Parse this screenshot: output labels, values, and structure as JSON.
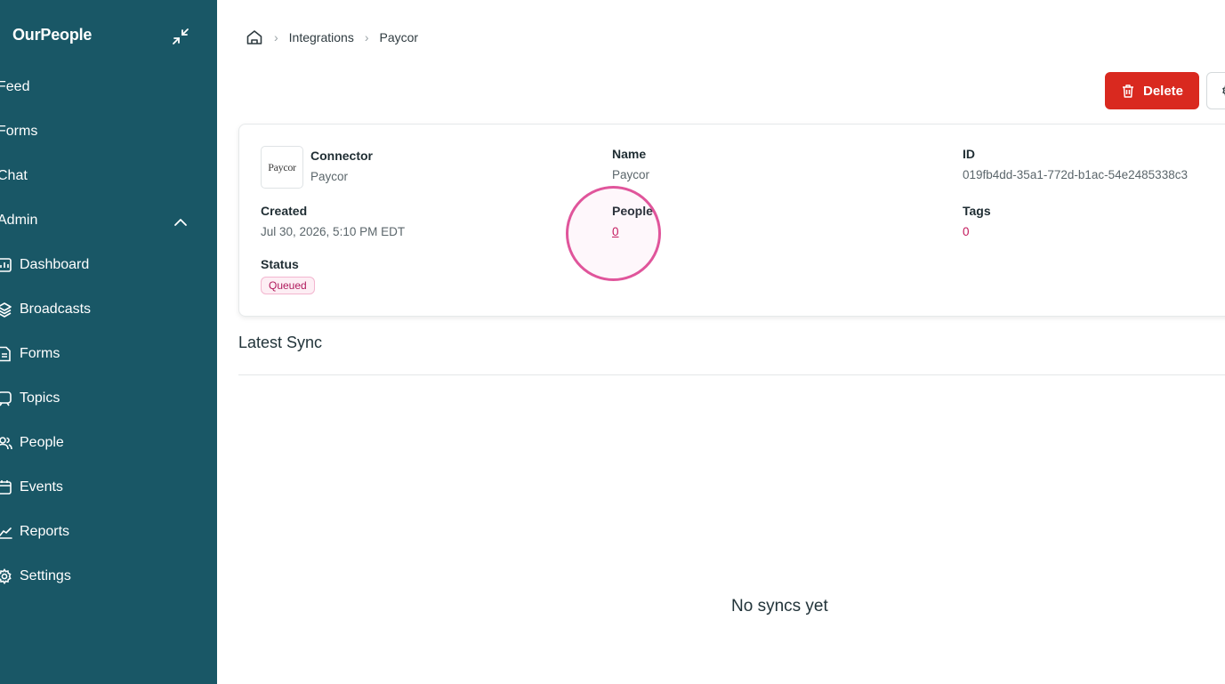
{
  "sidebar": {
    "brand": "OurPeople",
    "items": [
      {
        "label": "Feed"
      },
      {
        "label": "Forms"
      },
      {
        "label": "Chat"
      },
      {
        "label": "Admin"
      }
    ],
    "admin_items": [
      {
        "label": "Dashboard",
        "icon": "dashboard-icon"
      },
      {
        "label": "Broadcasts",
        "icon": "broadcasts-icon"
      },
      {
        "label": "Forms",
        "icon": "forms-icon"
      },
      {
        "label": "Topics",
        "icon": "topics-icon"
      },
      {
        "label": "People",
        "icon": "people-icon"
      },
      {
        "label": "Events",
        "icon": "calendar-icon"
      },
      {
        "label": "Reports",
        "icon": "reports-icon"
      },
      {
        "label": "Settings",
        "icon": "settings-icon"
      }
    ]
  },
  "breadcrumb": {
    "home_icon": "home-icon",
    "items": [
      "Integrations",
      "Paycor"
    ]
  },
  "actions": {
    "delete_label": "Delete",
    "delete_color": "#d9291f"
  },
  "details": {
    "logo_text": "Paycor",
    "connector_label": "Connector",
    "connector_value": "Paycor",
    "name_label": "Name",
    "name_value": "Paycor",
    "id_label": "ID",
    "id_value": "019fb4dd-35a1-772d-b1ac-54e2485338c3",
    "created_label": "Created",
    "created_value": "Jul 30, 2026, 5:10 PM EDT",
    "people_label": "People",
    "people_value": "0",
    "tags_label": "Tags",
    "tags_value": "0",
    "status_label": "Status",
    "status_value": "Queued"
  },
  "latest_sync": {
    "title": "Latest Sync",
    "empty_text": "No syncs yet"
  },
  "colors": {
    "sidebar": "#195766",
    "accent_link": "#c2185b",
    "highlight": "#e0559b"
  }
}
